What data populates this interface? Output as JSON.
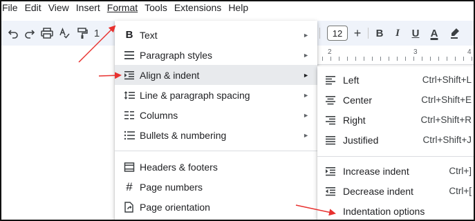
{
  "menubar": {
    "items": [
      "File",
      "Edit",
      "View",
      "Insert",
      "Format",
      "Tools",
      "Extensions",
      "Help"
    ]
  },
  "toolbar": {
    "undo_icon": "undo-icon",
    "redo_icon": "redo-icon",
    "print_icon": "print-icon",
    "spellcheck_icon": "spellcheck-icon",
    "paint_format_icon": "paint-format-icon",
    "partial_text": "1",
    "font_size": "12",
    "plus": "+",
    "bold": "B",
    "italic": "I",
    "underline": "U",
    "text_color": "A",
    "highlight_icon": "highlighter-icon"
  },
  "ruler": {
    "marks": [
      "2",
      "3",
      "4"
    ]
  },
  "format_menu": {
    "items": [
      {
        "label": "Text",
        "icon": "bold-b-icon",
        "glyph": "B",
        "submenu": true
      },
      {
        "label": "Paragraph styles",
        "icon": "paragraph-styles-icon",
        "glyph": "≡",
        "submenu": true
      },
      {
        "label": "Align & indent",
        "icon": "align-indent-icon",
        "glyph": "⇥",
        "submenu": true,
        "highlighted": true
      },
      {
        "label": "Line & paragraph spacing",
        "icon": "line-spacing-icon",
        "glyph": "↕",
        "submenu": true
      },
      {
        "label": "Columns",
        "icon": "columns-icon",
        "glyph": "☰",
        "submenu": true
      },
      {
        "label": "Bullets & numbering",
        "icon": "bulleted-list-icon",
        "glyph": "☰",
        "submenu": true
      },
      {
        "label": "Headers & footers",
        "icon": "header-footer-icon",
        "glyph": "▭",
        "submenu": false
      },
      {
        "label": "Page numbers",
        "icon": "hash-icon",
        "glyph": "#",
        "submenu": false
      },
      {
        "label": "Page orientation",
        "icon": "page-orientation-icon",
        "glyph": "⟳",
        "submenu": false
      }
    ],
    "submenu_arrow": "►"
  },
  "align_submenu": {
    "items": [
      {
        "label": "Left",
        "shortcut": "Ctrl+Shift+L",
        "icon": "align-left-icon",
        "glyph": "≡"
      },
      {
        "label": "Center",
        "shortcut": "Ctrl+Shift+E",
        "icon": "align-center-icon",
        "glyph": "≡"
      },
      {
        "label": "Right",
        "shortcut": "Ctrl+Shift+R",
        "icon": "align-right-icon",
        "glyph": "≡"
      },
      {
        "label": "Justified",
        "shortcut": "Ctrl+Shift+J",
        "icon": "align-justify-icon",
        "glyph": "≡"
      },
      {
        "label": "Increase indent",
        "shortcut": "Ctrl+]",
        "icon": "increase-indent-icon",
        "glyph": "⇥"
      },
      {
        "label": "Decrease indent",
        "shortcut": "Ctrl+[",
        "icon": "decrease-indent-icon",
        "glyph": "⇤"
      },
      {
        "label": "Indentation options",
        "shortcut": "",
        "icon": "",
        "glyph": ""
      }
    ]
  },
  "colors": {
    "annotation_arrow": "#e8312f",
    "highlight_row": "#e8eaed",
    "toolbar_bg": "#eff3fa"
  }
}
